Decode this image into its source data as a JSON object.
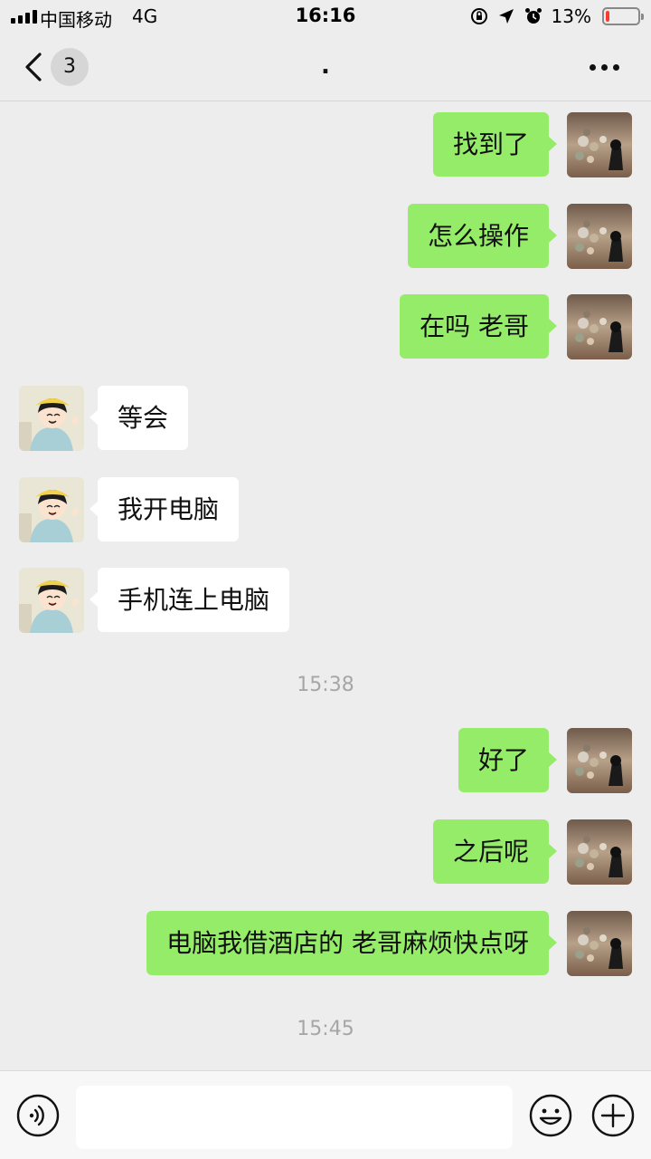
{
  "status_bar": {
    "carrier": "中国移动",
    "network": "4G",
    "time": "16:16",
    "battery_percent": "13%",
    "battery_level": 0.13,
    "icons": [
      "lock-rotation-icon",
      "location-arrow-icon",
      "alarm-icon",
      "battery-icon"
    ]
  },
  "nav": {
    "unread_count": "3",
    "title": ".",
    "back_icon": "chevron-left-icon",
    "more_icon": "more-dots-icon"
  },
  "messages": [
    {
      "side": "out",
      "text": "找到了"
    },
    {
      "side": "out",
      "text": "怎么操作"
    },
    {
      "side": "out",
      "text": "在吗 老哥"
    },
    {
      "side": "in",
      "text": "等会"
    },
    {
      "side": "in",
      "text": "我开电脑"
    },
    {
      "side": "in",
      "text": "手机连上电脑"
    },
    {
      "type": "time",
      "text": "15:38"
    },
    {
      "side": "out",
      "text": "好了"
    },
    {
      "side": "out",
      "text": "之后呢"
    },
    {
      "side": "out",
      "text": "电脑我借酒店的 老哥麻烦快点呀"
    },
    {
      "type": "time",
      "text": "15:45"
    }
  ],
  "input_bar": {
    "voice_icon": "voice-icon",
    "emoji_icon": "emoji-icon",
    "plus_icon": "plus-icon",
    "input_value": ""
  },
  "colors": {
    "outgoing_bubble": "#95ec69",
    "incoming_bubble": "#ffffff",
    "background": "#ededed",
    "battery_low": "#ff3b30"
  }
}
